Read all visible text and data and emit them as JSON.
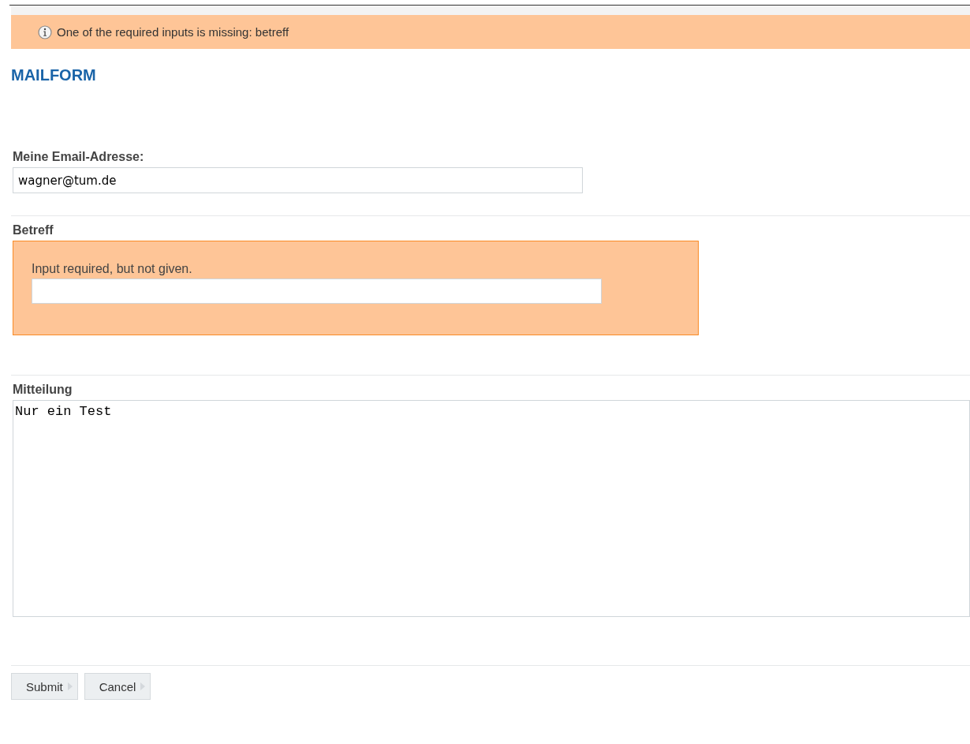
{
  "alert": {
    "message": "One of the required inputs is missing: betreff"
  },
  "title": "MAILFORM",
  "fields": [
    {
      "kind": "text",
      "label": "Meine Email-Adresse:",
      "value": "wagner@tum.de",
      "error": false
    },
    {
      "kind": "text",
      "label": "Betreff",
      "error": true,
      "error_message": "Input required, but not given."
    },
    {
      "kind": "textarea",
      "label": "Mitteilung",
      "value": "Nur ein Test",
      "error": false
    }
  ],
  "buttons": [
    "Submit",
    "Cancel"
  ]
}
